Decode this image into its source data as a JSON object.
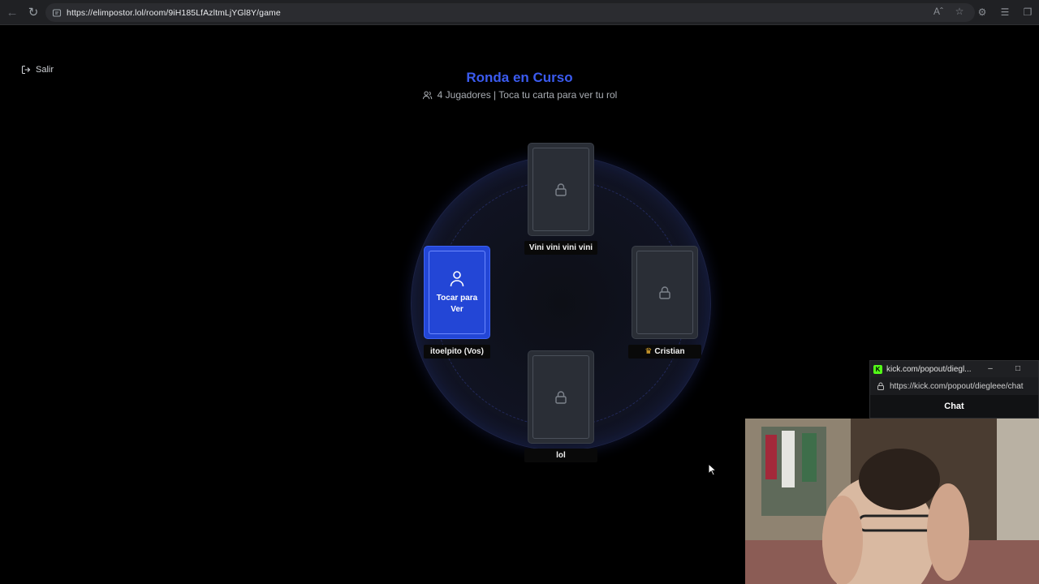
{
  "browser": {
    "url": "https://elimpostor.lol/room/9iH185LfAzltmLjYGl8Y/game"
  },
  "page": {
    "exit_label": "Salir",
    "title": "Ronda en Curso",
    "subtitle": "4 Jugadores | Toca tu carta para ver tu rol"
  },
  "players": [
    {
      "name": "Vini vini vini vini",
      "card": "locked"
    },
    {
      "name": "itoelpito (Vos)",
      "card": "mine",
      "card_label": "Tocar para Ver"
    },
    {
      "name": "Cristian",
      "card": "locked",
      "host_icon": "crown-icon"
    },
    {
      "name": "lol",
      "card": "locked"
    }
  ],
  "popout": {
    "title": "kick.com/popout/diegl...",
    "url": "https://kick.com/popout/diegleee/chat",
    "chat_label": "Chat"
  },
  "colors": {
    "accent": "#3b5bf0",
    "my_card": "#2346d6",
    "locked_card": "#2a2e36",
    "crown": "#f2b632",
    "kick_green": "#53fc18"
  }
}
